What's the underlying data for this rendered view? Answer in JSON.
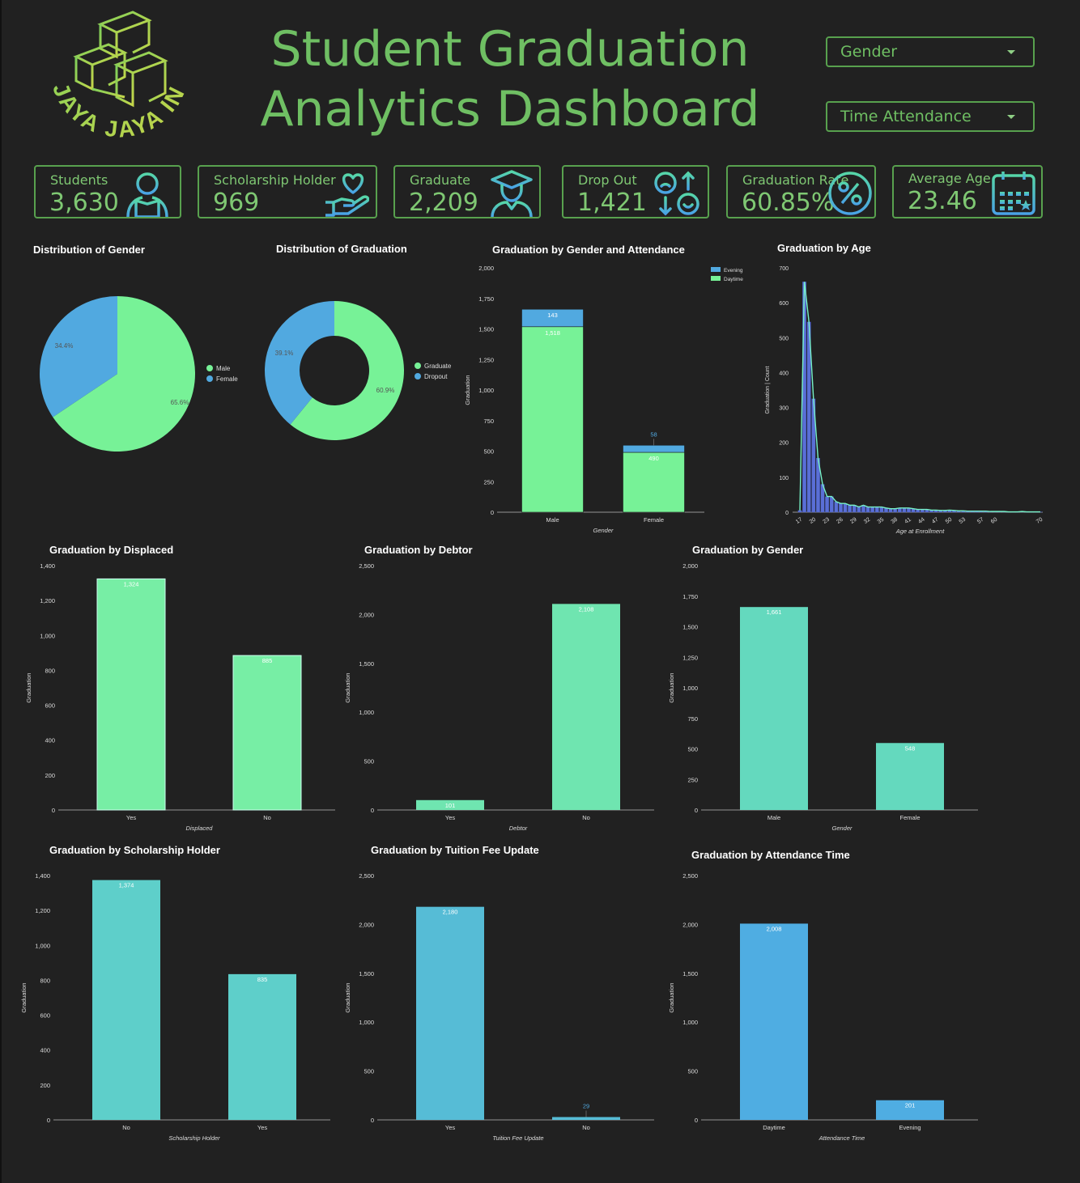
{
  "header": {
    "title_line1": "Student Graduation",
    "title_line2": "Analytics Dashboard",
    "logo_text": "JAYA JAYA INSTITUTE"
  },
  "filters": {
    "gender": "Gender",
    "attendance": "Time Attendance"
  },
  "kpis": [
    {
      "label": "Students",
      "value": "3,630",
      "icon": "student-reading-icon"
    },
    {
      "label": "Scholarship Holder",
      "value": "969",
      "icon": "heart-hand-icon"
    },
    {
      "label": "Graduate",
      "value": "2,209",
      "icon": "graduate-icon"
    },
    {
      "label": "Drop Out",
      "value": "1,421",
      "icon": "swap-faces-icon"
    },
    {
      "label": "Graduation Rate",
      "value": "60.85%",
      "icon": "percent-icon"
    },
    {
      "label": "Average Age",
      "value": "23.46",
      "icon": "calendar-icon"
    }
  ],
  "colors": {
    "green": "#77f297",
    "blue": "#51a9e0",
    "accent": "#6fbf63"
  },
  "chart_data": [
    {
      "id": "gender_pie",
      "type": "pie",
      "title": "Distribution of Gender",
      "labels": [
        "Male",
        "Female"
      ],
      "values": [
        65.6,
        34.4
      ],
      "value_labels": [
        "65.6%",
        "34.4%"
      ],
      "legend": "right"
    },
    {
      "id": "graduation_donut",
      "type": "pie",
      "title": "Distribution of Graduation",
      "labels": [
        "Graduate",
        "Dropout"
      ],
      "values": [
        60.9,
        39.1
      ],
      "value_labels": [
        "60.9%",
        "39.1%"
      ],
      "legend": "right"
    },
    {
      "id": "gender_attendance",
      "type": "bar",
      "stacked": true,
      "title": "Graduation by Gender and Attendance",
      "categories": [
        "Male",
        "Female"
      ],
      "series": [
        {
          "name": "Daytime",
          "values": [
            1518,
            490
          ]
        },
        {
          "name": "Evening",
          "values": [
            143,
            58
          ]
        }
      ],
      "value_labels": [
        [
          "1,518",
          "490"
        ],
        [
          "143",
          "58"
        ]
      ],
      "xlabel": "Gender",
      "ylabel": "Graduation",
      "ylim": [
        0,
        2000
      ],
      "yticks": [
        "0",
        "250",
        "500",
        "750",
        "1,000",
        "1,250",
        "1,500",
        "1,750",
        "2,000"
      ],
      "legend": "top-right"
    },
    {
      "id": "age",
      "type": "bar",
      "title": "Graduation by Age",
      "x": [
        17,
        18,
        19,
        20,
        21,
        22,
        23,
        24,
        25,
        26,
        27,
        28,
        29,
        30,
        31,
        32,
        33,
        34,
        35,
        36,
        37,
        38,
        39,
        40,
        41,
        42,
        43,
        44,
        45,
        46,
        47,
        48,
        49,
        50,
        51,
        52,
        53,
        54,
        55,
        56,
        57,
        58,
        59,
        60,
        61,
        62,
        63,
        64,
        65,
        66,
        67,
        68,
        69,
        70
      ],
      "values": [
        5,
        660,
        545,
        325,
        155,
        80,
        45,
        45,
        30,
        25,
        25,
        20,
        20,
        15,
        20,
        15,
        15,
        15,
        15,
        12,
        10,
        10,
        12,
        12,
        12,
        10,
        8,
        8,
        8,
        6,
        6,
        5,
        5,
        6,
        5,
        4,
        4,
        3,
        3,
        3,
        3,
        3,
        2,
        2,
        2,
        2,
        1,
        1,
        1,
        2,
        1,
        1,
        1,
        1
      ],
      "line_values": [
        5,
        660,
        545,
        325,
        155,
        80,
        45,
        45,
        30,
        25,
        25,
        20,
        20,
        15,
        20,
        15,
        15,
        15,
        15,
        12,
        10,
        10,
        12,
        12,
        12,
        10,
        8,
        8,
        8,
        6,
        6,
        5,
        5,
        6,
        5,
        4,
        4,
        3,
        3,
        3,
        3,
        3,
        2,
        2,
        2,
        2,
        1,
        1,
        1,
        2,
        1,
        1,
        1,
        1
      ],
      "xticks": [
        "17",
        "20",
        "23",
        "26",
        "29",
        "32",
        "35",
        "38",
        "41",
        "44",
        "47",
        "50",
        "53",
        "57",
        "60",
        "70"
      ],
      "xlabel": "Age at Enrollment",
      "ylabel": "Graduation | Count",
      "ylim": [
        0,
        700
      ],
      "yticks": [
        "0",
        "100",
        "200",
        "300",
        "400",
        "500",
        "600",
        "700"
      ]
    },
    {
      "id": "displaced",
      "type": "bar",
      "title": "Graduation by Displaced",
      "categories": [
        "Yes",
        "No"
      ],
      "values": [
        1324,
        885
      ],
      "value_labels": [
        "1,324",
        "885"
      ],
      "xlabel": "Displaced",
      "ylabel": "Graduation",
      "ylim": [
        0,
        1400
      ],
      "yticks": [
        "0",
        "200",
        "400",
        "600",
        "800",
        "1,000",
        "1,200",
        "1,400"
      ]
    },
    {
      "id": "debtor",
      "type": "bar",
      "title": "Graduation by Debtor",
      "categories": [
        "Yes",
        "No"
      ],
      "values": [
        101,
        2108
      ],
      "value_labels": [
        "101",
        "2,108"
      ],
      "xlabel": "Debtor",
      "ylabel": "Graduation",
      "ylim": [
        0,
        2500
      ],
      "yticks": [
        "0",
        "500",
        "1,000",
        "1,500",
        "2,000",
        "2,500"
      ]
    },
    {
      "id": "gender",
      "type": "bar",
      "title": "Graduation by Gender",
      "categories": [
        "Male",
        "Female"
      ],
      "values": [
        1661,
        548
      ],
      "value_labels": [
        "1,661",
        "548"
      ],
      "xlabel": "Gender",
      "ylabel": "Graduation",
      "ylim": [
        0,
        2000
      ],
      "yticks": [
        "0",
        "250",
        "500",
        "750",
        "1,000",
        "1,250",
        "1,500",
        "1,750",
        "2,000"
      ]
    },
    {
      "id": "scholarship",
      "type": "bar",
      "title": "Graduation by Scholarship Holder",
      "categories": [
        "No",
        "Yes"
      ],
      "values": [
        1374,
        835
      ],
      "value_labels": [
        "1,374",
        "835"
      ],
      "xlabel": "Scholarship Holder",
      "ylabel": "Graduation",
      "ylim": [
        0,
        1400
      ],
      "yticks": [
        "0",
        "200",
        "400",
        "600",
        "800",
        "1,000",
        "1,200",
        "1,400"
      ]
    },
    {
      "id": "tuition",
      "type": "bar",
      "title": "Graduation by Tuition Fee Update",
      "categories": [
        "Yes",
        "No"
      ],
      "values": [
        2180,
        29
      ],
      "value_labels": [
        "2,180",
        "29"
      ],
      "xlabel": "Tuition Fee Update",
      "ylabel": "Graduation",
      "ylim": [
        0,
        2500
      ],
      "yticks": [
        "0",
        "500",
        "1,000",
        "1,500",
        "2,000",
        "2,500"
      ]
    },
    {
      "id": "attendance",
      "type": "bar",
      "title": "Graduation by Attendance Time",
      "categories": [
        "Daytime",
        "Evening"
      ],
      "values": [
        2008,
        201
      ],
      "value_labels": [
        "2,008",
        "201"
      ],
      "xlabel": "Attendance Time",
      "ylabel": "Graduation",
      "ylim": [
        0,
        2500
      ],
      "yticks": [
        "0",
        "500",
        "1,000",
        "1,500",
        "2,000",
        "2,500"
      ]
    }
  ]
}
